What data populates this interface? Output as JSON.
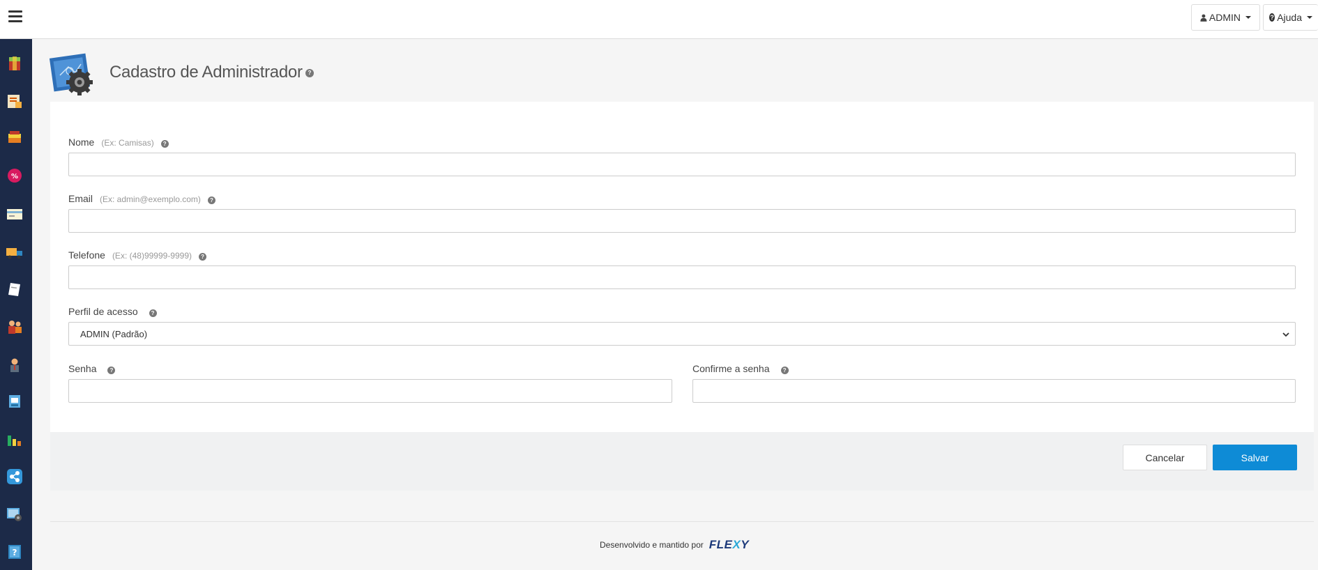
{
  "topbar": {
    "admin_label": "ADMIN",
    "help_label": "Ajuda"
  },
  "page": {
    "title": "Cadastro de Administrador"
  },
  "form": {
    "nome": {
      "label": "Nome",
      "hint": "(Ex: Camisas)",
      "value": ""
    },
    "email": {
      "label": "Email",
      "hint": "(Ex: admin@exemplo.com)",
      "value": ""
    },
    "telefone": {
      "label": "Telefone",
      "hint": "(Ex: (48)99999-9999)",
      "value": ""
    },
    "perfil": {
      "label": "Perfil de acesso",
      "selected": "ADMIN (Padrão)"
    },
    "senha": {
      "label": "Senha",
      "value": ""
    },
    "confirme": {
      "label": "Confirme a senha",
      "value": ""
    }
  },
  "actions": {
    "cancel_label": "Cancelar",
    "save_label": "Salvar"
  },
  "footer": {
    "text": "Desenvolvido e mantido por",
    "brand_prefix": "FLE",
    "brand_x": "X",
    "brand_suffix": "Y"
  },
  "help_glyph": "?",
  "sidebar_icons": [
    "box-icon",
    "document-icon",
    "layers-icon",
    "discount-icon",
    "card-icon",
    "truck-icon",
    "paper-icon",
    "users-icon",
    "person-icon",
    "app-icon",
    "chart-icon",
    "share-icon",
    "settings-icon",
    "help-book-icon"
  ],
  "colors": {
    "sidebar": "#1c2a48",
    "primary": "#0e8bd6",
    "brand": "#1d3a7a"
  }
}
